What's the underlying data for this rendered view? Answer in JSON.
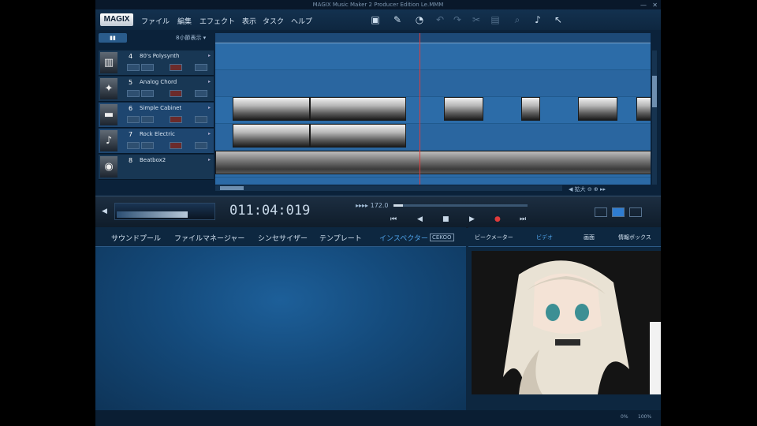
{
  "window": {
    "title": "MAGIX Music Maker 2 Producer Edition    Le.MMM",
    "min": "—",
    "close": "✕"
  },
  "menu": {
    "logo": "MAGIX",
    "items": [
      "ファイル",
      "編集",
      "エフェクト",
      "表示",
      "タスク",
      "ヘルプ"
    ]
  },
  "toolbar": {
    "icons": [
      "save-icon",
      "scissors-knife-icon",
      "mix-icon",
      "undo-icon",
      "redo-icon",
      "cut-icon",
      "delete-icon",
      "zoom-icon",
      "note-icon",
      "pointer-icon"
    ]
  },
  "arranger": {
    "view_button": "▮▮",
    "zoom_label": "8小節表示 ▾",
    "tracks": [
      {
        "num": "4",
        "name": "80's Polysynth",
        "icon": "keyboard-icon",
        "selected": false
      },
      {
        "num": "5",
        "name": "Analog Chord",
        "icon": "microphone-icon",
        "selected": false
      },
      {
        "num": "6",
        "name": "Simple Cabinet",
        "icon": "amp-icon",
        "selected": true
      },
      {
        "num": "7",
        "name": "Rock Electric",
        "icon": "guitar-icon",
        "selected": true
      },
      {
        "num": "8",
        "name": "Beatbox2",
        "icon": "drum-icon",
        "selected": false
      }
    ],
    "zoom_controls": "◀  拡大  ⊖ ⊕ ▸▸"
  },
  "transport": {
    "timecode": "011:04:019",
    "tempo": "▸▸▸▸ 172.0",
    "controls": [
      "⏮",
      "◀",
      "■",
      "▶",
      "●",
      "⏭"
    ]
  },
  "tabs_left": {
    "items": [
      "サウンドプール",
      "ファイルマネージャー",
      "シンセサイザー",
      "テンプレート",
      "インスペクター"
    ],
    "badge": "CEKOO"
  },
  "tabs_right": {
    "items": [
      "ビークメーター",
      "ビデオ",
      "画面",
      "情報ボックス"
    ]
  },
  "status": {
    "cpu": "0%",
    "zoom": "100%"
  }
}
